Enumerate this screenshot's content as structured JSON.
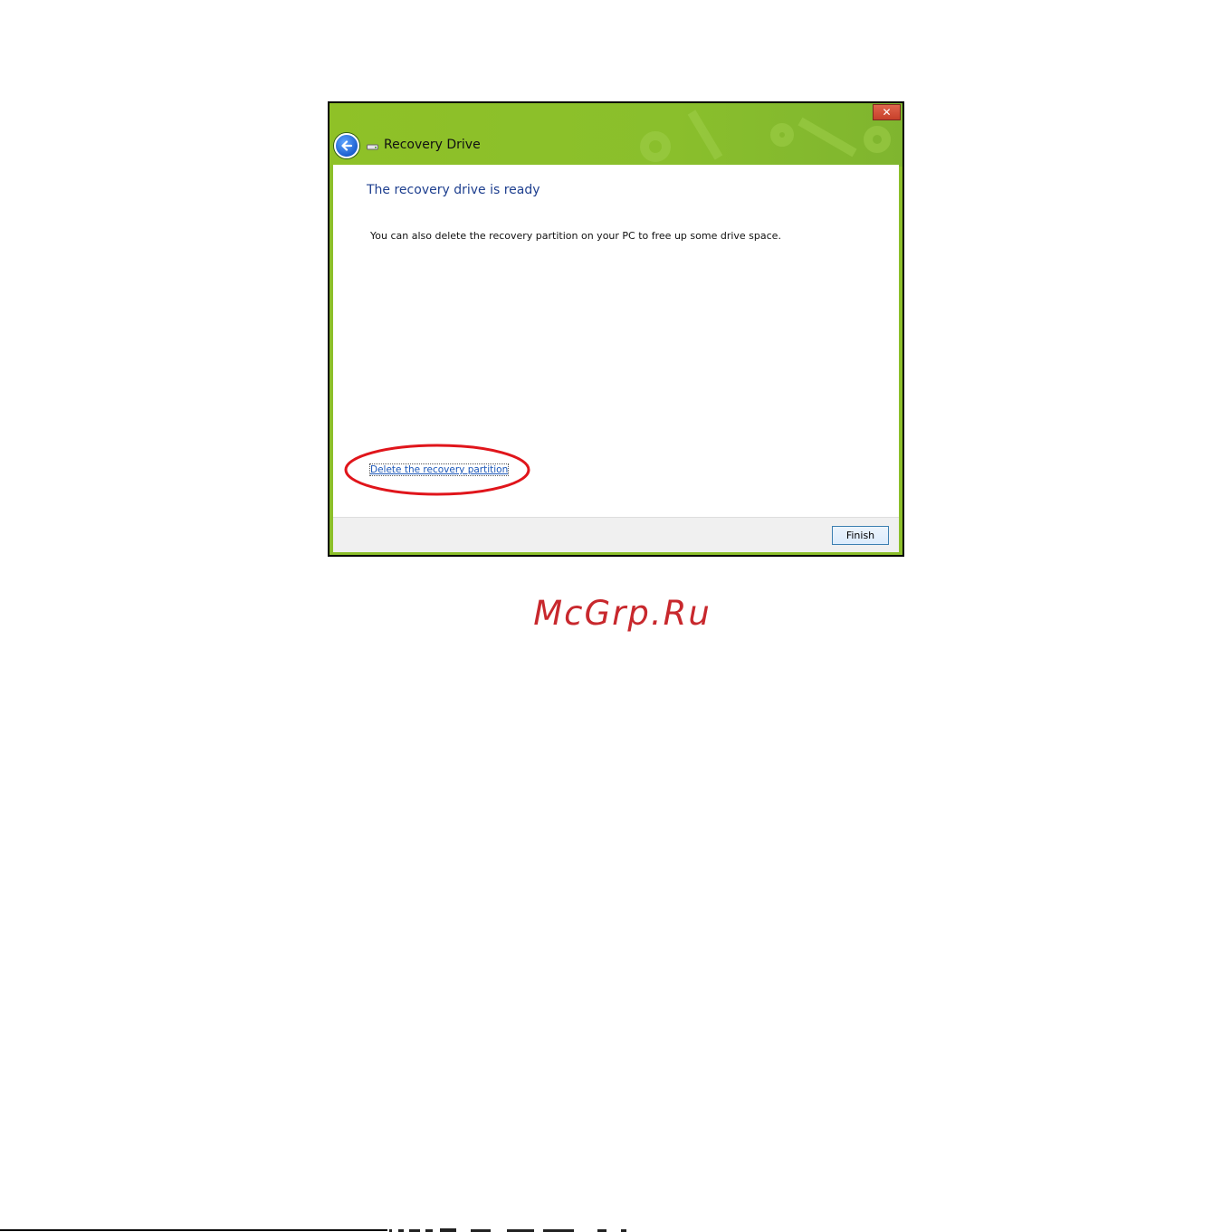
{
  "window": {
    "title": "Recovery Drive",
    "close_label": "✕"
  },
  "content": {
    "heading": "The recovery drive is ready",
    "body": "You can also delete the recovery partition on your PC to free up some drive space.",
    "link": "Delete the recovery partition"
  },
  "footer": {
    "finish_label": "Finish"
  },
  "watermark": "McGrp.Ru",
  "colors": {
    "chrome": "#8cbf2a",
    "heading": "#1e3f8f",
    "link": "#1a56b8",
    "annotation": "#e0151b",
    "watermark": "#c8282d"
  },
  "icons": {
    "back": "arrow-left-icon",
    "drive": "drive-icon",
    "close": "close-icon"
  }
}
